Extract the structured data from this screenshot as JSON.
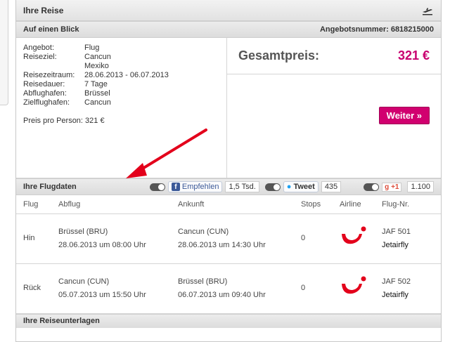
{
  "header": {
    "title": "Ihre Reise",
    "icon": "plane-icon"
  },
  "glance": {
    "title": "Auf einen Blick",
    "offer_number": "Angebotsnummer: 6818215000"
  },
  "details": [
    {
      "key": "Angebot:",
      "value": "Flug"
    },
    {
      "key": "Reiseziel:",
      "value": "Cancun"
    },
    {
      "key": "",
      "value": "Mexiko"
    },
    {
      "key": "Reisezeitraum:",
      "value": "28.06.2013 - 06.07.2013"
    },
    {
      "key": "Reisedauer:",
      "value": "7 Tage"
    },
    {
      "key": "Abflughafen:",
      "value": "Brüssel"
    },
    {
      "key": "Zielflughafen:",
      "value": "Cancun"
    }
  ],
  "price_per_person": "Preis pro Person: 321 €",
  "total": {
    "label": "Gesamtpreis:",
    "value": "321 €"
  },
  "weiter_button": "Weiter »",
  "flights": {
    "title": "Ihre Flugdaten",
    "social": {
      "fb_label": "Empfehlen",
      "fb_count": "1,5 Tsd.",
      "tw_label": "Tweet",
      "tw_count": "435",
      "gp_label": "+1",
      "gp_count": "1.100"
    },
    "columns": [
      "Flug",
      "Abflug",
      "Ankunft",
      "Stops",
      "Airline",
      "Flug-Nr."
    ],
    "rows": [
      {
        "type": "Hin",
        "dep_airport": "Brüssel (BRU)",
        "dep_time": "28.06.2013 um 08:00 Uhr",
        "arr_airport": "Cancun (CUN)",
        "arr_time": "28.06.2013 um 14:30 Uhr",
        "stops": "0",
        "flight_no": "JAF 501",
        "airline": "Jetairfly"
      },
      {
        "type": "Rück",
        "dep_airport": "Cancun (CUN)",
        "dep_time": "05.07.2013 um 15:50 Uhr",
        "arr_airport": "Brüssel (BRU)",
        "arr_time": "06.07.2013 um 09:40 Uhr",
        "stops": "0",
        "flight_no": "JAF 502",
        "airline": "Jetairfly"
      }
    ]
  },
  "documents_title": "Ihre Reiseunterlagen",
  "colors": {
    "accent": "#c8006f",
    "arrow": "#e3001b",
    "logo": "#e3001b"
  }
}
